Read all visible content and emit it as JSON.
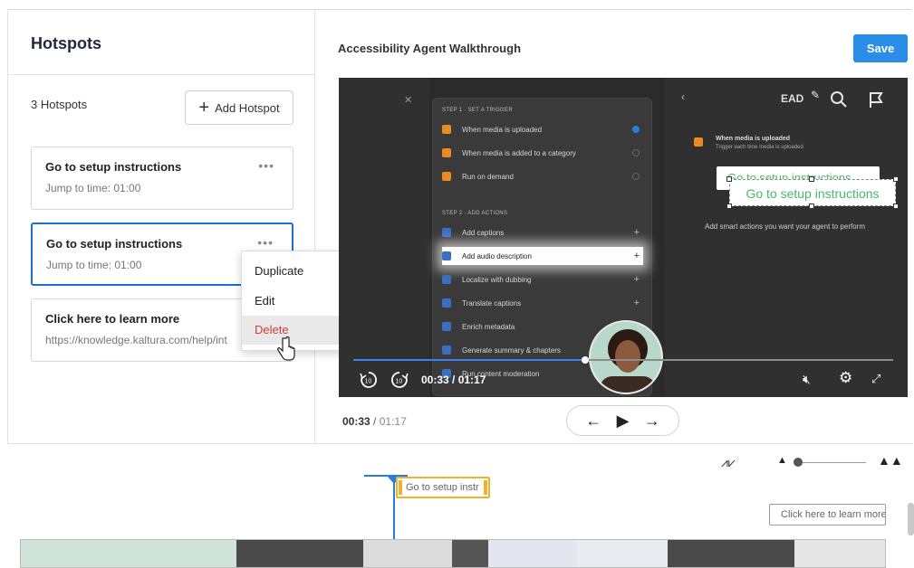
{
  "left_panel": {
    "title": "Hotspots",
    "count_label": "3 Hotspots",
    "add_button": "Add Hotspot",
    "more_glyph": "•••",
    "hotspots": [
      {
        "title": "Go to setup instructions",
        "subtitle": "Jump to time: 01:00"
      },
      {
        "title": "Go to setup instructions",
        "subtitle": "Jump to time: 01:00"
      },
      {
        "title": "Click here to learn more",
        "subtitle": "https://knowledge.kaltura.com/help/int"
      }
    ]
  },
  "context_menu": {
    "items": [
      "Duplicate",
      "Edit",
      "Delete"
    ]
  },
  "editor": {
    "title": "Accessibility Agent Walkthrough",
    "save": "Save"
  },
  "video": {
    "step1_header": "STEP 1 · SET A TRIGGER",
    "triggers": [
      "When media is uploaded",
      "When media is added to a category",
      "Run on demand"
    ],
    "step2_header": "STEP 2 · ADD ACTIONS",
    "actions": [
      "Add captions",
      "Add audio description",
      "Localize with dubbing",
      "Translate captions",
      "Enrich metadata",
      "Generate summary & chapters",
      "Run content moderation"
    ],
    "ead_label": "EAD",
    "trigger_title": "When media is uploaded",
    "trigger_sub": "Trigger each time media is uploaded",
    "smart_text": "Add smart actions you want your agent to perform",
    "hotspot_ghost": "Go to setup instructions",
    "hotspot_text": "Go to setup instructions",
    "time": "00:33 / 01:17",
    "progress_fraction": 0.43
  },
  "playback": {
    "current": "00:33",
    "separator": "/",
    "total": "01:17"
  },
  "timeline": {
    "hotspot1": "Go to setup instr",
    "hotspot2": "Click here to learn more"
  },
  "colors": {
    "accent": "#2b8ee6",
    "selection": "#1a6fd1",
    "delete": "#d23a3a",
    "hotspot_text": "#4ab86b",
    "timeline_hotspot": "#f0b12c"
  }
}
